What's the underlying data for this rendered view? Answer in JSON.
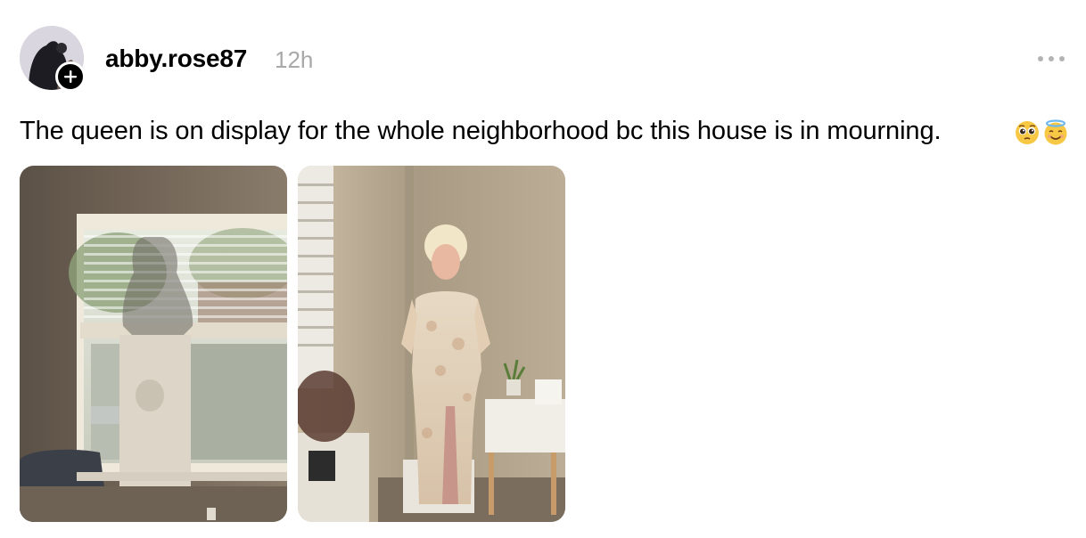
{
  "post": {
    "username": "abby.rose87",
    "timestamp": "12h",
    "caption": "The queen is on display for the whole neighborhood bc this house is in mourning.",
    "emojis": [
      "pleading-face-emoji",
      "smiling-face-with-halo-emoji"
    ]
  },
  "icons": {
    "follow": "plus-icon",
    "more": "more-horizontal-icon"
  },
  "images": [
    {
      "name": "photo-window-silhouette",
      "alt": ""
    },
    {
      "name": "photo-cutout-indoor",
      "alt": ""
    }
  ]
}
